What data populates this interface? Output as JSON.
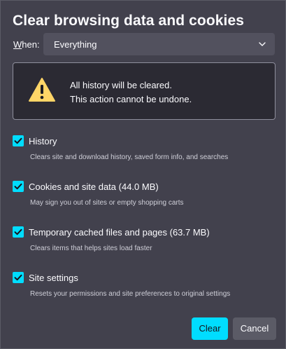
{
  "dialog": {
    "title": "Clear browsing data and cookies",
    "when_prefix": "W",
    "when_rest": "hen:",
    "when_value": "Everything",
    "icons": {
      "warning": "warning-triangle-icon",
      "dropdown": "chevron-down-icon",
      "check": "checkmark-icon"
    },
    "warning": {
      "line1": "All history will be cleared.",
      "line2": "This action cannot be undone."
    },
    "options": [
      {
        "label": "History",
        "description": "Clears site and download history, saved form info, and searches",
        "checked": true
      },
      {
        "label": "Cookies and site data (44.0 MB)",
        "description": "May sign you out of sites or empty shopping carts",
        "checked": true
      },
      {
        "label": "Temporary cached files and pages (63.7 MB)",
        "description": "Clears items that helps sites load faster",
        "checked": true
      },
      {
        "label": "Site settings",
        "description": "Resets your permissions and site preferences to original settings",
        "checked": true
      }
    ],
    "buttons": {
      "clear": "Clear",
      "cancel": "Cancel"
    },
    "colors": {
      "accent": "#00ddff",
      "background": "#42414d",
      "panel": "#2b2a33",
      "warning": "#ffd567"
    }
  }
}
